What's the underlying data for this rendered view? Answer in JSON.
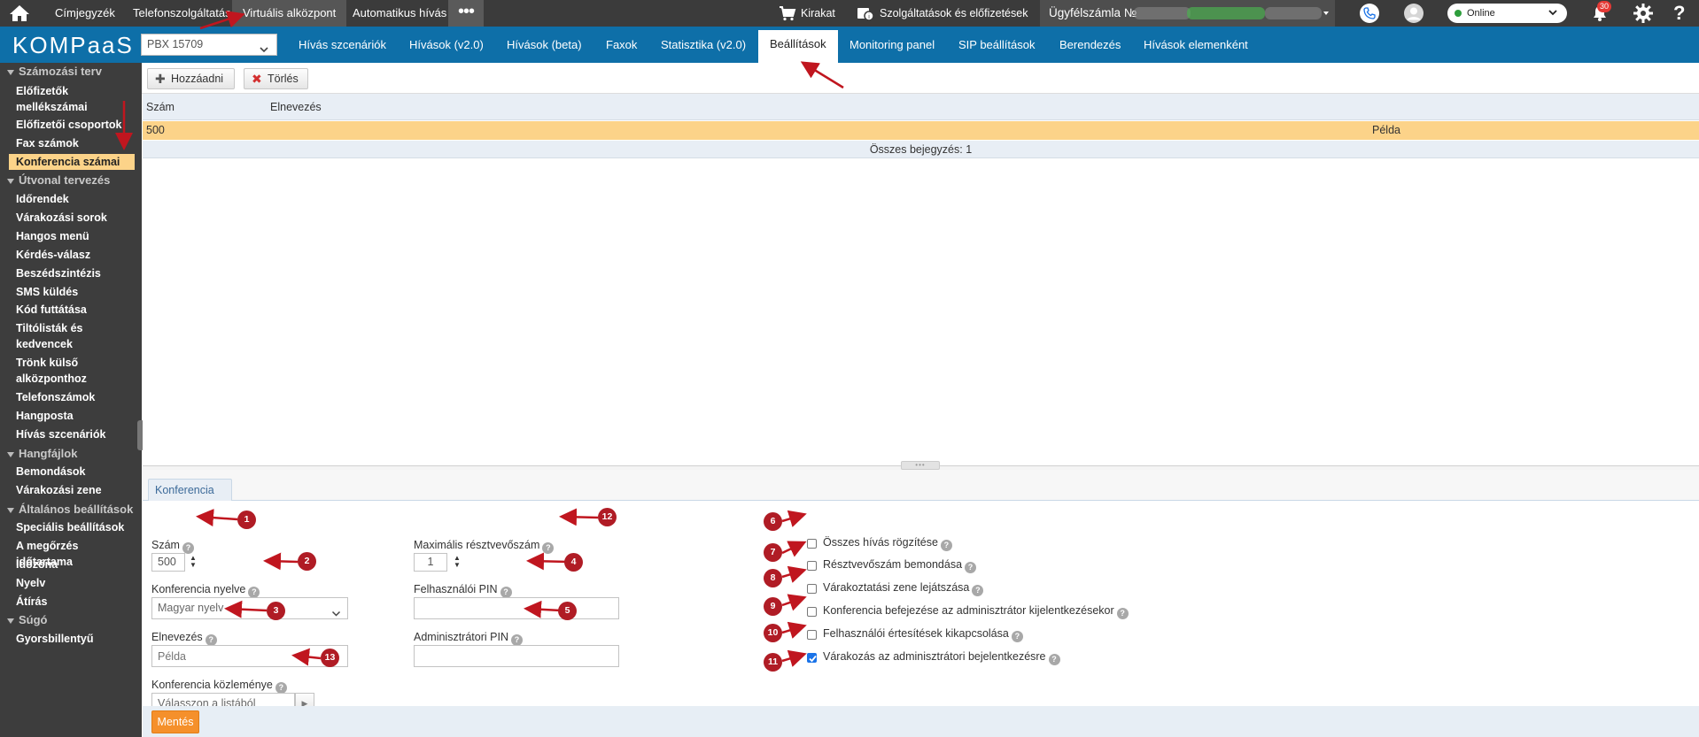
{
  "topbar": {
    "nav": [
      {
        "label": "Címjegyzék"
      },
      {
        "label": "Telefonszolgáltatás"
      },
      {
        "label": "Virtuális alközpont"
      },
      {
        "label": "Automatikus hívás"
      }
    ],
    "more_label": "•••",
    "showcase_label": "Kirakat",
    "services_label": "Szolgáltatások és előfizetések",
    "account_label": "Ügyfélszámla №",
    "status_value": "Online",
    "notifications_count": "30",
    "help_glyph": "?"
  },
  "navbar": {
    "logo": "KOMPaaS",
    "pbx_select": "PBX 15709",
    "tabs": [
      {
        "label": "Hívás szcenáriók"
      },
      {
        "label": "Hívások (v2.0)"
      },
      {
        "label": "Hívások (beta)"
      },
      {
        "label": "Faxok"
      },
      {
        "label": "Statisztika (v2.0)"
      },
      {
        "label": "Beállítások"
      },
      {
        "label": "Monitoring panel"
      },
      {
        "label": "SIP beállítások"
      },
      {
        "label": "Berendezés"
      },
      {
        "label": "Hívások elemenként"
      }
    ]
  },
  "sidebar": {
    "groups": [
      {
        "label": "Számozási terv"
      },
      {
        "label": "Útvonal tervezés"
      },
      {
        "label": "Hangfájlok"
      },
      {
        "label": "Általános beállítások"
      },
      {
        "label": "Súgó"
      }
    ],
    "items": [
      {
        "label": "Előfizetők"
      },
      {
        "label": "mellékszámai"
      },
      {
        "label": "Előfizetői csoportok"
      },
      {
        "label": "Fax számok"
      },
      {
        "label": "Konferencia számai"
      },
      {
        "label": "Időrendek"
      },
      {
        "label": "Várakozási sorok"
      },
      {
        "label": "Hangos menü"
      },
      {
        "label": "Kérdés-válasz"
      },
      {
        "label": "Beszédszintézis"
      },
      {
        "label": "SMS küldés"
      },
      {
        "label": "Kód futtátása"
      },
      {
        "label": "Tiltólisták és"
      },
      {
        "label": "kedvencek"
      },
      {
        "label": "Trönk külső"
      },
      {
        "label": "alközponthoz"
      },
      {
        "label": "Telefonszámok"
      },
      {
        "label": "Hangposta"
      },
      {
        "label": "Hívás szcenáriók"
      },
      {
        "label": "Bemondások"
      },
      {
        "label": "Várakozási zene"
      },
      {
        "label": "Speciális beállítások"
      },
      {
        "label": "A megőrzés időtartama"
      },
      {
        "label": "Időzóna"
      },
      {
        "label": "Nyelv"
      },
      {
        "label": "Átírás"
      },
      {
        "label": "Gyorsbillentyű"
      }
    ]
  },
  "toolbar": {
    "add_label": "Hozzáadni",
    "delete_label": "Törlés"
  },
  "table": {
    "columns": [
      "Szám",
      "Elnevezés"
    ],
    "rows": [
      {
        "number": "500",
        "name": "Példa"
      }
    ],
    "footer": "Összes bejegyzés: 1"
  },
  "form": {
    "tab_label": "Konferencia",
    "number_label": "Szám",
    "number_value": "500",
    "language_label": "Konferencia nyelve",
    "language_value": "Magyar nyelv",
    "name_label": "Elnevezés",
    "name_placeholder": "Példa",
    "announcement_label": "Konferencia közleménye",
    "announcement_value": "Válasszon a listából",
    "max_participants_label": "Maximális résztvevőszám",
    "max_participants_value": "1",
    "user_pin_label": "Felhasználói PIN",
    "user_pin_value": "",
    "admin_pin_label": "Adminisztrátori PIN",
    "admin_pin_value": "",
    "checkboxes": [
      {
        "label": "Összes hívás rögzítése",
        "checked": false
      },
      {
        "label": "Résztvevőszám bemondása",
        "checked": false
      },
      {
        "label": "Várakoztatási zene lejátszása",
        "checked": false
      },
      {
        "label": "Konferencia befejezése az adminisztrátor kijelentkezésekor",
        "checked": false
      },
      {
        "label": "Felhasználói értesítések kikapcsolása",
        "checked": false
      },
      {
        "label": "Várakozás az adminisztrátori bejelentkezésre",
        "checked": true
      }
    ],
    "help_glyph": "?",
    "save_label": "Mentés"
  },
  "badges": [
    "1",
    "2",
    "3",
    "4",
    "5",
    "6",
    "7",
    "8",
    "9",
    "10",
    "11",
    "12",
    "13"
  ],
  "colors": {
    "topbar_bg": "#3b3b3b",
    "navbar_bg": "#0e6fa8",
    "sidebar_bg": "#3d3d3d",
    "selected_row": "#fcd389",
    "save_button": "#f5902b",
    "annotation_red": "#b01c25"
  }
}
